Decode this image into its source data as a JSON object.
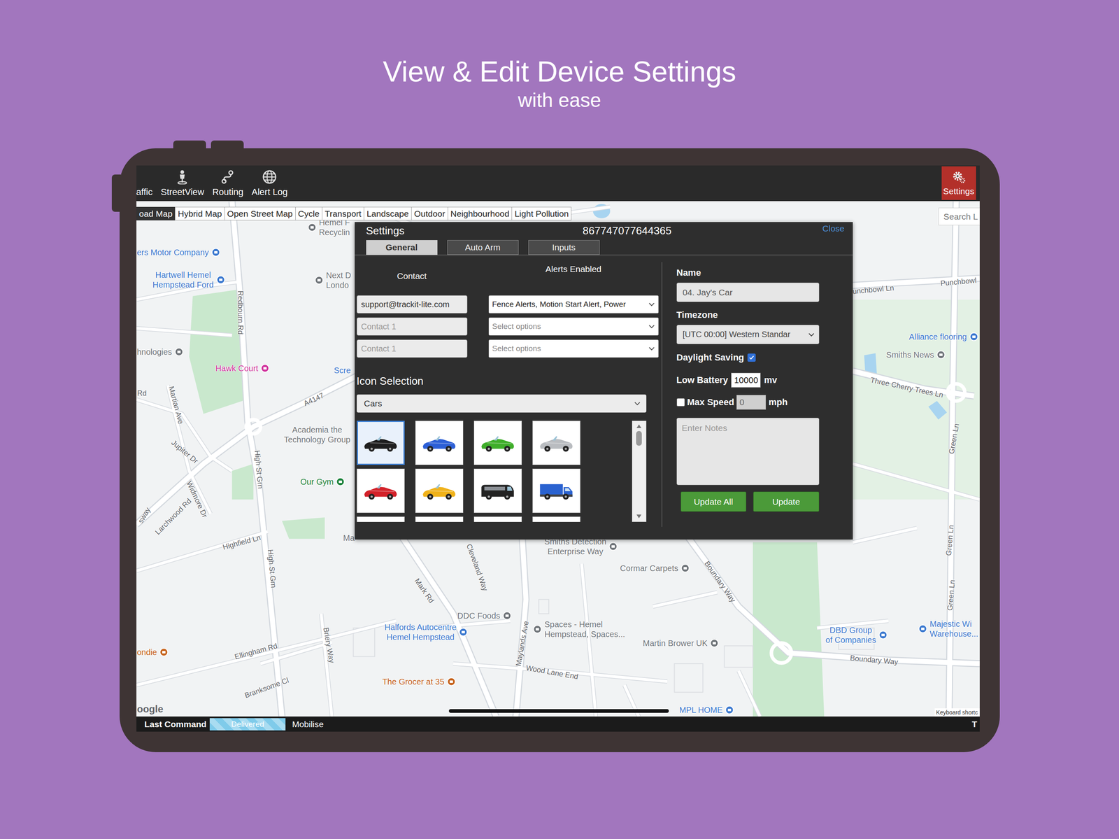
{
  "header": {
    "title": "View & Edit Device Settings",
    "subtitle": "with ease"
  },
  "toolbar": {
    "items": [
      {
        "label": "affic",
        "kind": "partial"
      },
      {
        "label": "StreetView",
        "kind": "streetview"
      },
      {
        "label": "Routing",
        "kind": "routing"
      },
      {
        "label": "Alert Log",
        "kind": "globe"
      }
    ],
    "settings": {
      "label": "Settings",
      "selected": true
    }
  },
  "map_types": [
    {
      "label": "oad Map",
      "selected": true
    },
    {
      "label": "Hybrid Map",
      "selected": false
    },
    {
      "label": "Open Street Map",
      "selected": false
    },
    {
      "label": "Cycle",
      "selected": false
    },
    {
      "label": "Transport",
      "selected": false
    },
    {
      "label": "Landscape",
      "selected": false
    },
    {
      "label": "Outdoor",
      "selected": false
    },
    {
      "label": "Neighbourhood",
      "selected": false
    },
    {
      "label": "Light Pollution",
      "selected": false
    }
  ],
  "search": {
    "text": "Search L"
  },
  "map_labels": [
    {
      "text": "ers Motor Company",
      "kind": "poi",
      "color": "#3a78cf"
    },
    {
      "text": "Hartwell Hemel\nHempstead Ford",
      "kind": "poi",
      "color": "#3a78cf"
    },
    {
      "text": "Hemel F\nRecyclin",
      "kind": "poi",
      "color": "#70757a"
    },
    {
      "text": "Next D\nLondo",
      "kind": "poi",
      "color": "#70757a"
    },
    {
      "text": "Redbourn Rd",
      "kind": "road"
    },
    {
      "text": "hnologies",
      "kind": "poi",
      "color": "#70757a"
    },
    {
      "text": "Hawk Court",
      "kind": "poi",
      "color": "#d0339d"
    },
    {
      "text": "Scre",
      "kind": "poi",
      "color": "#3a78cf"
    },
    {
      "text": "Rd",
      "kind": "road"
    },
    {
      "text": "Martian Ave",
      "kind": "road"
    },
    {
      "text": "A4147",
      "kind": "road"
    },
    {
      "text": "Academia the\nTechnology Group",
      "kind": "poi",
      "color": "#70757a"
    },
    {
      "text": "Jupiter Dr",
      "kind": "road"
    },
    {
      "text": "High St Grn",
      "kind": "road"
    },
    {
      "text": "Our Gym",
      "kind": "poi",
      "color": "#188038"
    },
    {
      "text": "Widmore Dr",
      "kind": "road"
    },
    {
      "text": "Larchwood Rd",
      "kind": "road"
    },
    {
      "text": "sway",
      "kind": "road"
    },
    {
      "text": "Highfield Ln",
      "kind": "road"
    },
    {
      "text": "High St Grn",
      "kind": "road"
    },
    {
      "text": "Ma",
      "kind": "poi",
      "color": "#70757a"
    },
    {
      "text": "Cleveland Way",
      "kind": "road"
    },
    {
      "text": "Mark Rd",
      "kind": "road"
    },
    {
      "text": "Smiths Detection\nEnterprise Way",
      "kind": "poi",
      "color": "#70757a"
    },
    {
      "text": "Cormar Carpets",
      "kind": "poi",
      "color": "#70757a"
    },
    {
      "text": "Boundary Way",
      "kind": "road"
    },
    {
      "text": "DDC Foods",
      "kind": "poi",
      "color": "#70757a"
    },
    {
      "text": "Spaces - Hemel\nHempstead, Spaces...",
      "kind": "poi",
      "color": "#70757a"
    },
    {
      "text": "Halfords Autocentre\nHemel Hempstead",
      "kind": "poi",
      "color": "#3a78cf"
    },
    {
      "text": "Maylands Ave",
      "kind": "road"
    },
    {
      "text": "Martin Brower UK",
      "kind": "poi",
      "color": "#70757a"
    },
    {
      "text": "Briery Way",
      "kind": "road"
    },
    {
      "text": "Ellingham Rd",
      "kind": "road"
    },
    {
      "text": "ondie",
      "kind": "poi",
      "color": "#c5621b"
    },
    {
      "text": "Wood Lane End",
      "kind": "road"
    },
    {
      "text": "The Grocer at 35",
      "kind": "poi",
      "color": "#c5621b"
    },
    {
      "text": "Branksome Cl",
      "kind": "road"
    },
    {
      "text": "DBD Group\nof Companies",
      "kind": "poi",
      "color": "#3a78cf"
    },
    {
      "text": "Majestic Wi\nWarehouse...",
      "kind": "poi",
      "color": "#3a78cf"
    },
    {
      "text": "Boundary Way",
      "kind": "road"
    },
    {
      "text": "MPL HOME",
      "kind": "poi",
      "color": "#3a78cf"
    },
    {
      "text": "Green Ln",
      "kind": "road"
    },
    {
      "text": "Green Ln",
      "kind": "road"
    },
    {
      "text": "Green Ln",
      "kind": "road"
    },
    {
      "text": "Punchbowl",
      "kind": "road"
    },
    {
      "text": "unchbowl Ln",
      "kind": "road"
    },
    {
      "text": "Alliance flooring",
      "kind": "poi",
      "color": "#3a78cf"
    },
    {
      "text": "Smiths News",
      "kind": "poi",
      "color": "#70757a"
    },
    {
      "text": "Three Cherry Trees Ln",
      "kind": "road"
    }
  ],
  "map_footer": {
    "google": "oogle",
    "shortcuts": "Keyboard shortc"
  },
  "dialog": {
    "title": "Settings",
    "device_id": "867747077644365",
    "close": "Close",
    "tabs": [
      {
        "label": "General",
        "selected": true
      },
      {
        "label": "Auto Arm",
        "selected": false
      },
      {
        "label": "Inputs",
        "selected": false
      }
    ],
    "contact_header": "Contact",
    "alerts_header": "Alerts Enabled",
    "contacts": [
      {
        "value": "support@trackit-lite.com"
      },
      {
        "placeholder": "Contact 1"
      },
      {
        "placeholder": "Contact 1"
      }
    ],
    "alerts": [
      {
        "value": "Fence Alerts, Motion Start Alert, Power"
      },
      {
        "placeholder": "Select options"
      },
      {
        "placeholder": "Select options"
      }
    ],
    "icon_selection": {
      "title": "Icon Selection",
      "category": "Cars",
      "icons": [
        {
          "kind": "car",
          "color": "#1e1e1e",
          "selected": true
        },
        {
          "kind": "car",
          "color": "#2c5fd6",
          "selected": false
        },
        {
          "kind": "car",
          "color": "#3fae2a",
          "selected": false
        },
        {
          "kind": "car",
          "color": "#b9bcc0",
          "selected": false
        },
        {
          "kind": "car",
          "color": "#d3222a",
          "selected": false
        },
        {
          "kind": "car",
          "color": "#f0b21a",
          "selected": false
        },
        {
          "kind": "van",
          "color": "#232323",
          "selected": false
        },
        {
          "kind": "truck",
          "color": "#2a62d0",
          "selected": false
        },
        {
          "kind": "car",
          "color": "#1e1e1e",
          "selected": false
        },
        {
          "kind": "car",
          "color": "#2c5fd6",
          "selected": false
        },
        {
          "kind": "car",
          "color": "#3fae2a",
          "selected": false
        },
        {
          "kind": "car",
          "color": "#b9bcc0",
          "selected": false
        }
      ]
    },
    "name": {
      "label": "Name",
      "value": "04. Jay's Car"
    },
    "timezone": {
      "label": "Timezone",
      "value": "[UTC 00:00] Western Standar"
    },
    "daylight_saving": {
      "label": "Daylight Saving",
      "checked": true
    },
    "low_battery": {
      "label": "Low Battery",
      "value": "10000",
      "unit": "mv"
    },
    "max_speed": {
      "label": "Max Speed",
      "checked": false,
      "value": "0",
      "unit": "mph",
      "disabled": true
    },
    "notes": {
      "placeholder": "Enter Notes"
    },
    "buttons": [
      "Update All",
      "Update"
    ]
  },
  "status_bar": {
    "label": "Last Command",
    "status": "Delivered",
    "level": 1,
    "command": "Mobilise",
    "tail": "T"
  }
}
